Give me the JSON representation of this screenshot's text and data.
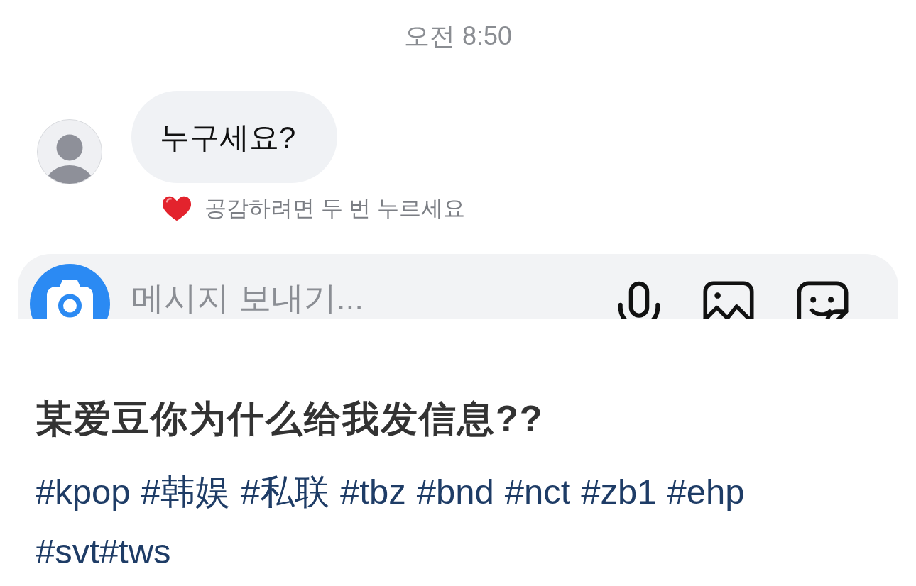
{
  "chat": {
    "timestamp": "오전 8:50",
    "message": {
      "text": "누구세요?"
    },
    "reaction_hint": "공감하려면 두 번 누르세요",
    "composer": {
      "placeholder": "메시지 보내기..."
    }
  },
  "post": {
    "title": "某爱豆你为什么给我发信息??",
    "hashtag_lines": [
      [
        "#kpop",
        "#韩娱",
        "#私联",
        "#tbz",
        "#bnd",
        "#nct",
        "#zb1",
        "#ehp"
      ],
      [
        "#svt#tws"
      ]
    ]
  }
}
